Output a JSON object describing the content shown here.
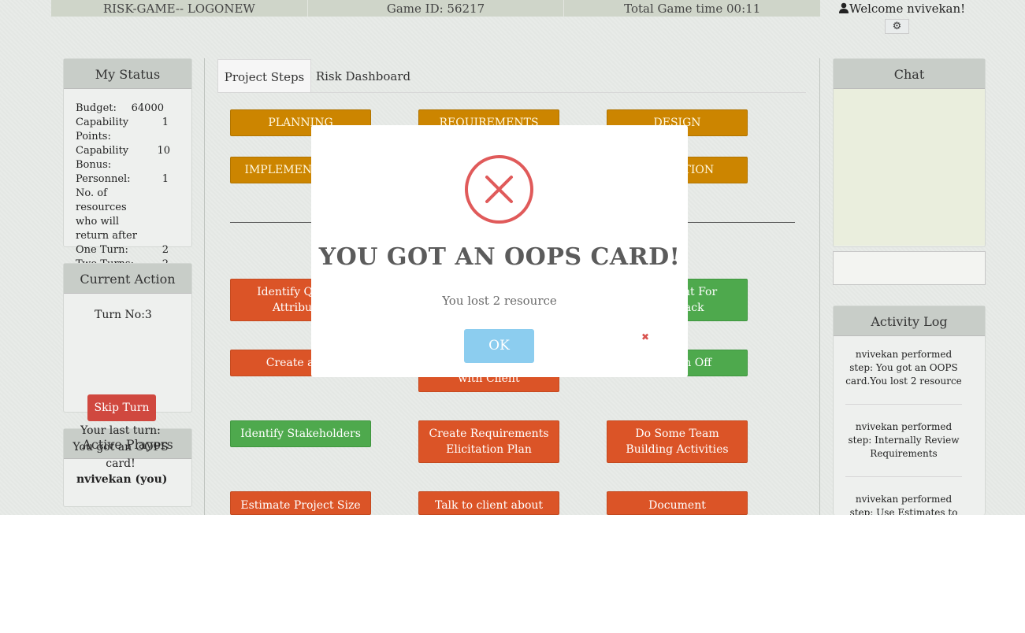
{
  "topbar": {
    "logo": "RISK-GAME-- LOGONEW",
    "game_id": "Game ID: 56217",
    "game_time": "Total Game time 00:11"
  },
  "user": {
    "welcome": "Welcome   nvivekan!"
  },
  "my_status": {
    "title": "My Status",
    "rows": [
      {
        "label": "Budget:",
        "value": "64000"
      },
      {
        "label": "Capability Points:",
        "value": "1"
      },
      {
        "label": "Capability Bonus:",
        "value": "10"
      },
      {
        "label": "Personnel:",
        "value": "1"
      }
    ],
    "return_label": "No. of resources who will return after",
    "rows2": [
      {
        "label": "One Turn:",
        "value": "2"
      },
      {
        "label": "Two Turns:",
        "value": "2"
      }
    ]
  },
  "current_action": {
    "title": "Current Action",
    "turn": "Turn No:3",
    "skip": "Skip Turn",
    "last_turn": "Your last turn: You got an OOPS card!"
  },
  "active_players": {
    "title": "Active Players",
    "player": "nvivekan (you)"
  },
  "tabs": [
    "Project Steps",
    "Risk Dashboard"
  ],
  "phases": [
    "PLANNING",
    "REQUIREMENTS",
    "DESIGN",
    "IMPLEMENTATION",
    "VALIDATION"
  ],
  "steps": {
    "identify_quality": "Identify Quality Attributes",
    "client_feedback": "Ask Client For Feedback",
    "create_plan": "Create an ...",
    "with_client": "with Client",
    "sign_off": "Get Sign Off",
    "stakeholders": "Identify Stakeholders",
    "elicitation": "Create Requirements Elicitation Plan",
    "team_building": "Do Some Team Building Activities",
    "estimate": "Estimate Project Size",
    "talk_client": "Talk to client about",
    "document": "Document"
  },
  "chat": {
    "title": "Chat"
  },
  "activity_log": {
    "title": "Activity Log",
    "items": [
      "nvivekan performed step: You got an OOPS card.You lost 2 resource",
      "nvivekan performed step: Internally Review Requirements",
      "nvivekan performed step: Use Estimates to Adjust"
    ]
  },
  "modal": {
    "title": "YOU GOT AN OOPS CARD!",
    "message": "You lost 2 resource",
    "ok": "OK"
  },
  "colors": {
    "phase": "#cc8500",
    "red": "#db5427",
    "green": "#4ea94d",
    "ok": "#8ccdef",
    "error": "#e05a5a"
  }
}
